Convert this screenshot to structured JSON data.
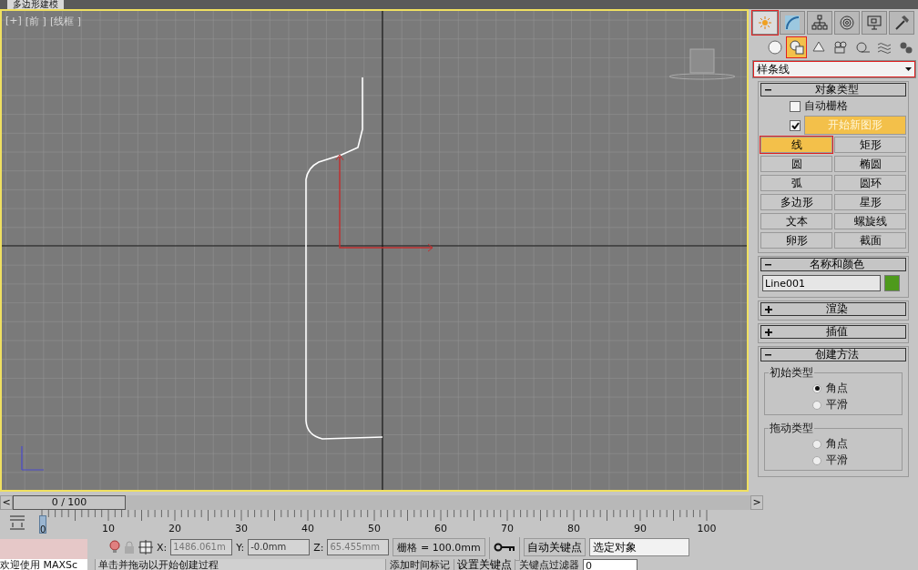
{
  "document_tab": {
    "title": "多边形建模"
  },
  "viewport": {
    "active": true,
    "labels": [
      "[+]",
      "[前 ]",
      "[线框 ]"
    ]
  },
  "command_panel": {
    "tabs": [
      {
        "kind": "create",
        "selected": true,
        "annotated": true
      },
      {
        "kind": "modify",
        "selected": false,
        "annotated": false
      },
      {
        "kind": "hierarchy",
        "selected": false,
        "annotated": false
      },
      {
        "kind": "motion",
        "selected": false,
        "annotated": false
      },
      {
        "kind": "display",
        "selected": false,
        "annotated": false
      },
      {
        "kind": "utilities",
        "selected": false,
        "annotated": false
      }
    ],
    "categories": [
      {
        "kind": "geometry",
        "selected": false,
        "annotated": false
      },
      {
        "kind": "shapes",
        "selected": true,
        "annotated": true
      },
      {
        "kind": "lights",
        "selected": false,
        "annotated": false
      },
      {
        "kind": "cameras",
        "selected": false,
        "annotated": false
      },
      {
        "kind": "helpers",
        "selected": false,
        "annotated": false
      },
      {
        "kind": "spacewarps",
        "selected": false,
        "annotated": false
      },
      {
        "kind": "systems",
        "selected": false,
        "annotated": false
      }
    ],
    "dropdown": {
      "value": "样条线",
      "annotated": true
    },
    "object_type": {
      "title": "对象类型",
      "expanded": true,
      "auto_grid": {
        "label": "自动栅格",
        "checked": false
      },
      "start_new_shape": {
        "label": "开始新图形",
        "checked": true
      },
      "buttons": [
        {
          "label": "线",
          "selected": true,
          "annotated": true
        },
        {
          "label": "矩形",
          "selected": false,
          "annotated": false
        },
        {
          "label": "圆",
          "selected": false,
          "annotated": false
        },
        {
          "label": "椭圆",
          "selected": false,
          "annotated": false
        },
        {
          "label": "弧",
          "selected": false,
          "annotated": false
        },
        {
          "label": "圆环",
          "selected": false,
          "annotated": false
        },
        {
          "label": "多边形",
          "selected": false,
          "annotated": false
        },
        {
          "label": "星形",
          "selected": false,
          "annotated": false
        },
        {
          "label": "文本",
          "selected": false,
          "annotated": false
        },
        {
          "label": "螺旋线",
          "selected": false,
          "annotated": false
        },
        {
          "label": "卵形",
          "selected": false,
          "annotated": false
        },
        {
          "label": "截面",
          "selected": false,
          "annotated": false
        }
      ]
    },
    "name_and_color": {
      "title": "名称和颜色",
      "expanded": true,
      "name": "Line001",
      "color": "#4e9a1c"
    },
    "collapsed_rollouts": [
      {
        "title": "渲染",
        "expanded": false
      },
      {
        "title": "插值",
        "expanded": false
      }
    ],
    "creation_method": {
      "title": "创建方法",
      "expanded": true,
      "groups": [
        {
          "title": "初始类型",
          "options": [
            {
              "label": "角点",
              "selected": true
            },
            {
              "label": "平滑",
              "selected": false
            }
          ]
        },
        {
          "title": "拖动类型",
          "options": [
            {
              "label": "角点",
              "selected": false
            },
            {
              "label": "平滑",
              "selected": false
            }
          ]
        }
      ]
    }
  },
  "time_slider": {
    "prev": "<",
    "label": "0 / 100",
    "next": ">",
    "level": 0
  },
  "track_bar": {
    "current_frame": "0",
    "tick_labels": [
      "10",
      "20",
      "30",
      "40",
      "50",
      "60",
      "70",
      "80",
      "90",
      "100"
    ]
  },
  "status_bar": {
    "listener": "欢迎使用 MAXSc",
    "prompt": "单击并拖动以开始创建过程",
    "coordinates": [
      {
        "axis": "X:",
        "value": "1486.061m",
        "disabled": true
      },
      {
        "axis": "Y:",
        "value": "-0.0mm",
        "disabled": false
      },
      {
        "axis": "Z:",
        "value": "65.455mm",
        "disabled": true
      }
    ],
    "grid": "栅格 = 100.0mm",
    "time_tag": "添加时间标记",
    "auto_key": "自动关键点",
    "set_key": "设置关键点",
    "selection_filter": "选定对象",
    "key_filters": "关键点过滤器",
    "frame": "0"
  }
}
